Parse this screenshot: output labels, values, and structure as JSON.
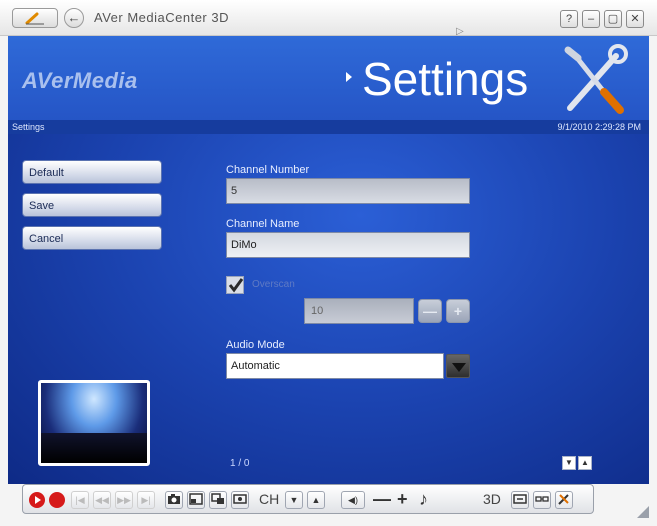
{
  "titlebar": {
    "title": "AVer MediaCenter 3D",
    "help_label": "?",
    "minimize_label": "–",
    "restore_label": "▢",
    "close_label": "✕",
    "back_label": "←"
  },
  "header": {
    "logo": "AVerMedia",
    "title": "Settings",
    "breadcrumb": "Settings",
    "datetime": "9/1/2010 2:29:28 PM"
  },
  "sidebar": {
    "default_label": "Default",
    "save_label": "Save",
    "cancel_label": "Cancel"
  },
  "form": {
    "channel_number_label": "Channel Number",
    "channel_number_value": "5",
    "channel_name_label": "Channel Name",
    "channel_name_value": "DiMo",
    "overscan_label": "Overscan",
    "overscan_checked": true,
    "overscan_value": "10",
    "audio_mode_label": "Audio Mode",
    "audio_mode_value": "Automatic"
  },
  "pager": {
    "count": "1 / 0"
  },
  "toolbar": {
    "ch_label": "CH",
    "threed_label": "3D",
    "minus_label": "—",
    "plus_label": "+",
    "prev_label": "|◀",
    "rew_label": "◀◀",
    "ff_label": "▶▶",
    "next_label": "▶|",
    "ch_down_label": "▼",
    "ch_up_label": "▲",
    "volume_label": "◀)",
    "music_label": "♪"
  },
  "colors": {
    "panel_blue": "#1b43b0",
    "record_red": "#d61a1a"
  }
}
